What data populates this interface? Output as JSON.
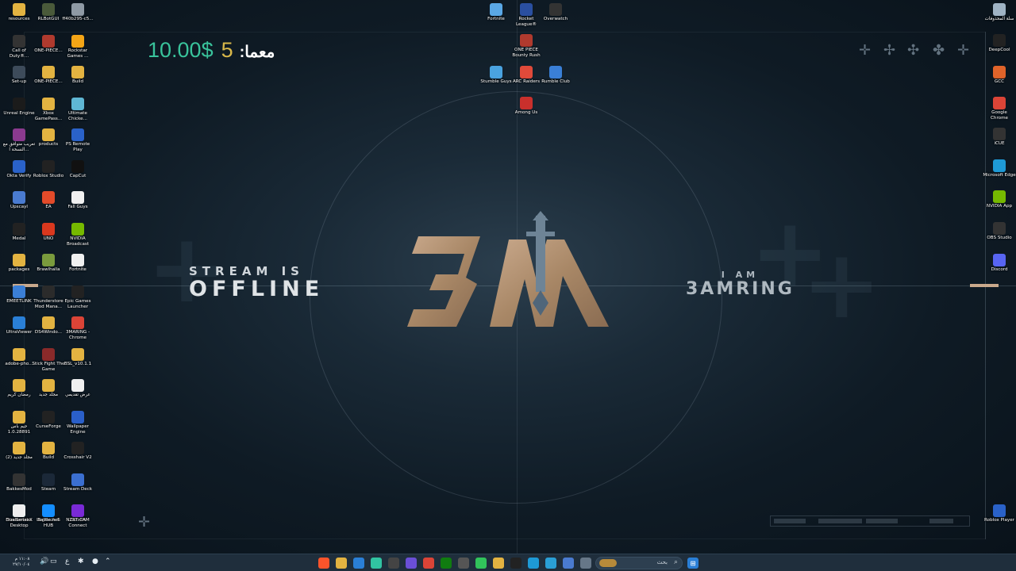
{
  "overlay": {
    "donation_amount": "10.00$",
    "donation_label": "معما:",
    "donation_trail": "5",
    "offline_line1": "STREAM IS",
    "offline_line2": "OFFLINE",
    "iam_line1": "I AM",
    "iam_line2": "3AMRING"
  },
  "colors": {
    "accent_green": "#39c39b",
    "accent_gold": "#c9a98c",
    "taskbar": "#1f2e3c"
  },
  "desktop_icons_left": [
    {
      "label": "resources",
      "icon": "folder-icon",
      "color": "#e3b341"
    },
    {
      "label": "RLBotGUI",
      "icon": "rlbot-icon",
      "color": "#4a5a3a"
    },
    {
      "label": "ff40b295-c5...",
      "icon": "file-icon",
      "color": "#8f9aa5"
    },
    {
      "label": "Call of Duty®...",
      "icon": "cod-icon",
      "color": "#333333"
    },
    {
      "label": "ONE-PIECE...",
      "icon": "game-icon",
      "color": "#b03a2e"
    },
    {
      "label": "Rockstar Games ...",
      "icon": "rockstar-icon",
      "color": "#f4a516"
    },
    {
      "label": "Set-up",
      "icon": "setup-icon",
      "color": "#3d4b5a"
    },
    {
      "label": "ONE-PIECE...",
      "icon": "folder-icon",
      "color": "#e3b341"
    },
    {
      "label": "Build",
      "icon": "folder-icon",
      "color": "#e3b341"
    },
    {
      "label": "Unreal Engine",
      "icon": "unreal-icon",
      "color": "#1b1b1b"
    },
    {
      "label": "Xbox GamePass...",
      "icon": "folder-icon",
      "color": "#e3b341"
    },
    {
      "label": "Ultimate Chicke...",
      "icon": "game-icon",
      "color": "#5fb7d4"
    },
    {
      "label": "تعريب متوافق مع النسخة ا...",
      "icon": "winrar-icon",
      "color": "#8b3a8f"
    },
    {
      "label": "products",
      "icon": "folder-icon",
      "color": "#e3b341"
    },
    {
      "label": "PS Remote Play",
      "icon": "ps-icon",
      "color": "#2a62c9"
    },
    {
      "label": "Okta Verify",
      "icon": "okta-icon",
      "color": "#2a62c9"
    },
    {
      "label": "Roblox Studio",
      "icon": "roblox-icon",
      "color": "#222222"
    },
    {
      "label": "CapCut",
      "icon": "capcut-icon",
      "color": "#111111"
    },
    {
      "label": "Upscayl",
      "icon": "upscayl-icon",
      "color": "#4a7bd0"
    },
    {
      "label": "EA",
      "icon": "ea-icon",
      "color": "#e34b2a"
    },
    {
      "label": "Fall Guys",
      "icon": "file-icon",
      "color": "#f0f0f0"
    },
    {
      "label": "Medal",
      "icon": "medal-icon",
      "color": "#222222"
    },
    {
      "label": "UNO",
      "icon": "uno-icon",
      "color": "#d9381e"
    },
    {
      "label": "NVIDIA Broadcast",
      "icon": "nvidia-icon",
      "color": "#76b900"
    },
    {
      "label": "packages",
      "icon": "folder-icon",
      "color": "#e3b341"
    },
    {
      "label": "Brawlhalla",
      "icon": "brawlhalla-icon",
      "color": "#7a9b3d"
    },
    {
      "label": "Fortnite",
      "icon": "file-icon",
      "color": "#f0f0f0"
    },
    {
      "label": "EMEETLINK",
      "icon": "emeet-icon",
      "color": "#3b7fd6"
    },
    {
      "label": "Thunderstore Mod Mana...",
      "icon": "thunderstore-icon",
      "color": "#2b2b2b"
    },
    {
      "label": "Epic Games Launcher",
      "icon": "epic-icon",
      "color": "#222222"
    },
    {
      "label": "UltraViewer",
      "icon": "ultraviewer-icon",
      "color": "#2a7fd6"
    },
    {
      "label": "DS4Windo...",
      "icon": "folder-icon",
      "color": "#e3b341"
    },
    {
      "label": "3MARING - Chrome",
      "icon": "chrome-icon",
      "color": "#db4437"
    },
    {
      "label": "adobe-pho...",
      "icon": "folder-icon",
      "color": "#e3b341"
    },
    {
      "label": "Stick Fight The Game",
      "icon": "game-icon",
      "color": "#8a2a2a"
    },
    {
      "label": "BSL_v10.1.1",
      "icon": "folder-icon",
      "color": "#e3b341"
    },
    {
      "label": "رمضان كريم",
      "icon": "folder-icon",
      "color": "#e3b341"
    },
    {
      "label": "مجلد جديد",
      "icon": "folder-icon",
      "color": "#e3b341"
    },
    {
      "label": "عرض تقديمي",
      "icon": "presentation-icon",
      "color": "#f0f0f0"
    },
    {
      "label": "جيم باس 1.0.28891",
      "icon": "folder-icon",
      "color": "#e3b341"
    },
    {
      "label": "CurseForge",
      "icon": "curseforge-icon",
      "color": "#222222"
    },
    {
      "label": "Wallpaper Engine",
      "icon": "wallpaper-engine-icon",
      "color": "#2a5fc9"
    },
    {
      "label": "مجلد جديد (2)",
      "icon": "folder-icon",
      "color": "#e3b341"
    },
    {
      "label": "Build",
      "icon": "folder-icon",
      "color": "#e3b341"
    },
    {
      "label": "Crosshair V2",
      "icon": "crosshair-icon",
      "color": "#222222"
    },
    {
      "label": "BakkesMod",
      "icon": "bakkesmod-icon",
      "color": "#333333"
    },
    {
      "label": "Steam",
      "icon": "steam-icon",
      "color": "#1b2838"
    },
    {
      "label": "Stream Deck",
      "icon": "streamdeck-icon",
      "color": "#3b6fd0"
    },
    {
      "label": "Streamlabs Desktop",
      "icon": "streamlabs-icon",
      "color": "#31c3a2"
    },
    {
      "label": "Logitech G HUB",
      "icon": "logitech-icon",
      "color": "#222222"
    },
    {
      "label": "Ubisoft Connect",
      "icon": "ubisoft-icon",
      "color": "#3a3a3a"
    },
    {
      "label": "DualSenseX",
      "icon": "dualsense-icon",
      "color": "#eeeeee"
    },
    {
      "label": "Battle.net",
      "icon": "battlenet-icon",
      "color": "#148eff"
    },
    {
      "label": "NZXT CAM",
      "icon": "nzxt-icon",
      "color": "#7a2ad6"
    }
  ],
  "desktop_icons_center": [
    {
      "label": "Fortnite",
      "icon": "fortnite-icon",
      "color": "#5aa8e6"
    },
    {
      "label": "Rocket League®",
      "icon": "rocket-league-icon",
      "color": "#2a4fa0"
    },
    {
      "label": "Overwatch",
      "icon": "overwatch-icon",
      "color": "#333333"
    },
    {
      "label": "ONE PIECE Bounty Rush",
      "icon": "game-icon",
      "color": "#b03a2e"
    },
    {
      "label": "Stumble Guys",
      "icon": "stumble-icon",
      "color": "#4aa3e0"
    },
    {
      "label": "ARC Raiders",
      "icon": "arc-icon",
      "color": "#e04a3a"
    },
    {
      "label": "Rumble Club",
      "icon": "rumble-icon",
      "color": "#3a7fd6"
    },
    {
      "label": "Among Us",
      "icon": "amongus-icon",
      "color": "#c9302c"
    }
  ],
  "desktop_icons_right": [
    {
      "label": "سلة المحذوفات",
      "icon": "recycle-bin-icon",
      "color": "#9fb3c4"
    },
    {
      "label": "DeepCool",
      "icon": "deepcool-icon",
      "color": "#222222"
    },
    {
      "label": "GCC",
      "icon": "gcc-icon",
      "color": "#e0642a"
    },
    {
      "label": "Google Chrome",
      "icon": "chrome-icon",
      "color": "#db4437"
    },
    {
      "label": "iCUE",
      "icon": "icue-icon",
      "color": "#333333"
    },
    {
      "label": "Microsoft Edge",
      "icon": "edge-icon",
      "color": "#1e9ad6"
    },
    {
      "label": "NVIDIA App",
      "icon": "nvidia-icon",
      "color": "#76b900"
    },
    {
      "label": "OBS Studio",
      "icon": "obs-icon",
      "color": "#333333"
    },
    {
      "label": "Discord",
      "icon": "discord-icon",
      "color": "#5865f2"
    },
    {
      "label": "Roblox Player",
      "icon": "roblox-icon",
      "color": "#2a62c9"
    }
  ],
  "taskbar": {
    "search_placeholder": "بحث",
    "clock_time": "١١:٠٨ م",
    "clock_date": "٢٧/١٠/٠٤",
    "apps": [
      {
        "name": "brave-icon",
        "color": "#fb542b"
      },
      {
        "name": "file-explorer-icon",
        "color": "#e3b341"
      },
      {
        "name": "windows-store-icon",
        "color": "#2a7fd6"
      },
      {
        "name": "app-icon",
        "color": "#31c3a2"
      },
      {
        "name": "obs-icon",
        "color": "#444444"
      },
      {
        "name": "streamlabs-icon",
        "color": "#6a4fd6"
      },
      {
        "name": "chrome-icon",
        "color": "#db4437"
      },
      {
        "name": "xbox-icon",
        "color": "#107c10"
      },
      {
        "name": "capture-icon",
        "color": "#555555"
      },
      {
        "name": "play-icon",
        "color": "#31c35b"
      },
      {
        "name": "folder-icon",
        "color": "#e3b341"
      },
      {
        "name": "capcut-icon",
        "color": "#222222"
      },
      {
        "name": "edge-icon",
        "color": "#1e9ad6"
      },
      {
        "name": "edge-alt-icon",
        "color": "#2a9fd6"
      },
      {
        "name": "photos-icon",
        "color": "#4a7bd0"
      },
      {
        "name": "task-view-icon",
        "color": "#667788"
      }
    ]
  }
}
